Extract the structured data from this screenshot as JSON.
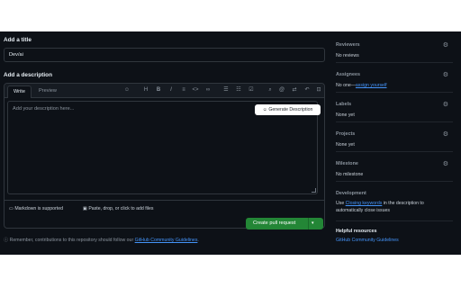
{
  "title_section": {
    "label": "Add a title",
    "value": "Dev/ai"
  },
  "description_section": {
    "label": "Add a description",
    "tabs": [
      "Write",
      "Preview"
    ],
    "toolbar_icons": [
      "heading-icon",
      "bold-icon",
      "italic-icon",
      "quote-icon",
      "code-icon",
      "link-icon",
      "unordered-list-icon",
      "ordered-list-icon",
      "task-list-icon",
      "attach-icon",
      "mention-icon",
      "cross-reference-icon",
      "undo-icon",
      "fullscreen-icon"
    ],
    "placeholder": "Add your description here...",
    "generate_button": "Generate Description",
    "markdown_note": "Markdown is supported",
    "attach_note": "Paste, drop, or click to add files"
  },
  "submit": {
    "label": "Create pull request"
  },
  "footer": {
    "remember_text": "Remember, contributions to this repository should follow our",
    "guidelines_link": "GitHub Community Guidelines",
    "period": "."
  },
  "sidebar": {
    "reviewers": {
      "title": "Reviewers",
      "value": "No reviews"
    },
    "assignees": {
      "title": "Assignees",
      "value_prefix": "No one—",
      "value_link": "assign yourself"
    },
    "labels": {
      "title": "Labels",
      "value": "None yet"
    },
    "projects": {
      "title": "Projects",
      "value": "None yet"
    },
    "milestone": {
      "title": "Milestone",
      "value": "No milestone"
    },
    "development": {
      "title": "Development",
      "text_prefix": "Use ",
      "link": "Closing keywords",
      "text_suffix": " in the description to automatically close issues"
    },
    "helpful": {
      "title": "Helpful resources",
      "link": "GitHub Community Guidelines"
    }
  },
  "colors": {
    "background": "#0d1117",
    "border": "#30363d",
    "accent_link": "#4493f8",
    "primary_button": "#238636"
  }
}
